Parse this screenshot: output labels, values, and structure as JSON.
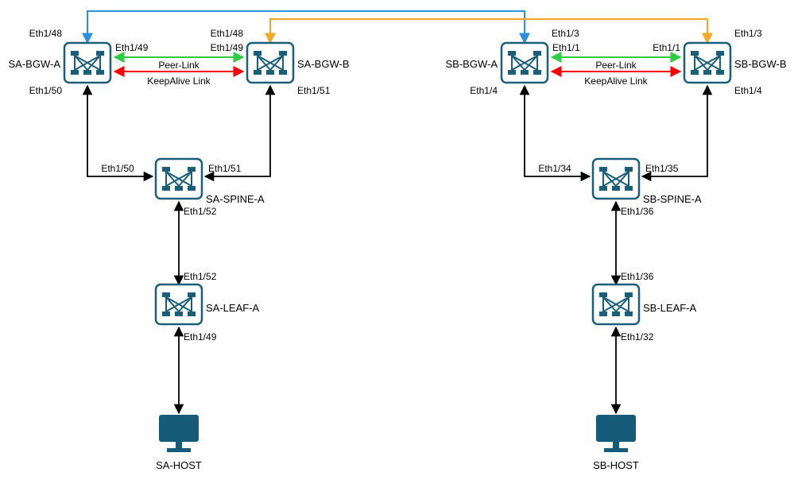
{
  "nodes": {
    "sa_bgw_a": "SA-BGW-A",
    "sa_bgw_b": "SA-BGW-B",
    "sb_bgw_a": "SB-BGW-A",
    "sb_bgw_b": "SB-BGW-B",
    "sa_spine_a": "SA-SPINE-A",
    "sb_spine_a": "SB-SPINE-A",
    "sa_leaf_a": "SA-LEAF-A",
    "sb_leaf_a": "SB-LEAF-A",
    "sa_host": "SA-HOST",
    "sb_host": "SB-HOST"
  },
  "links": {
    "peer_link": "Peer-Link",
    "keepalive": "KeepAlive Link"
  },
  "ports": {
    "sa_bgw_a_top": "Eth1/48",
    "sa_bgw_a_right": "Eth1/49",
    "sa_bgw_a_bottom": "Eth1/50",
    "sa_bgw_b_top": "Eth1/48",
    "sa_bgw_b_left": "Eth1/49",
    "sa_bgw_b_bottom": "Eth1/51",
    "sb_bgw_a_top": "Eth1/3",
    "sb_bgw_a_right": "Eth1/1",
    "sb_bgw_a_bottom": "Eth1/4",
    "sb_bgw_b_top": "Eth1/3",
    "sb_bgw_b_left": "Eth1/1",
    "sb_bgw_b_bottom": "Eth1/4",
    "sa_spine_left": "Eth1/50",
    "sa_spine_right": "Eth1/51",
    "sa_spine_bottom": "Eth1/52",
    "sb_spine_left": "Eth1/34",
    "sb_spine_right": "Eth1/35",
    "sb_spine_bottom": "Eth1/36",
    "sa_leaf_top": "Eth1/52",
    "sa_leaf_bottom": "Eth1/49",
    "sb_leaf_top": "Eth1/36",
    "sb_leaf_bottom": "Eth1/32"
  },
  "colors": {
    "node_stroke": "#1a5f7a",
    "node_fill": "#165a7a",
    "blue_line": "#2d8fdd",
    "orange_line": "#f5a623",
    "green_line": "#2ecc40",
    "red_line": "#ff0000",
    "black_line": "#000000"
  }
}
